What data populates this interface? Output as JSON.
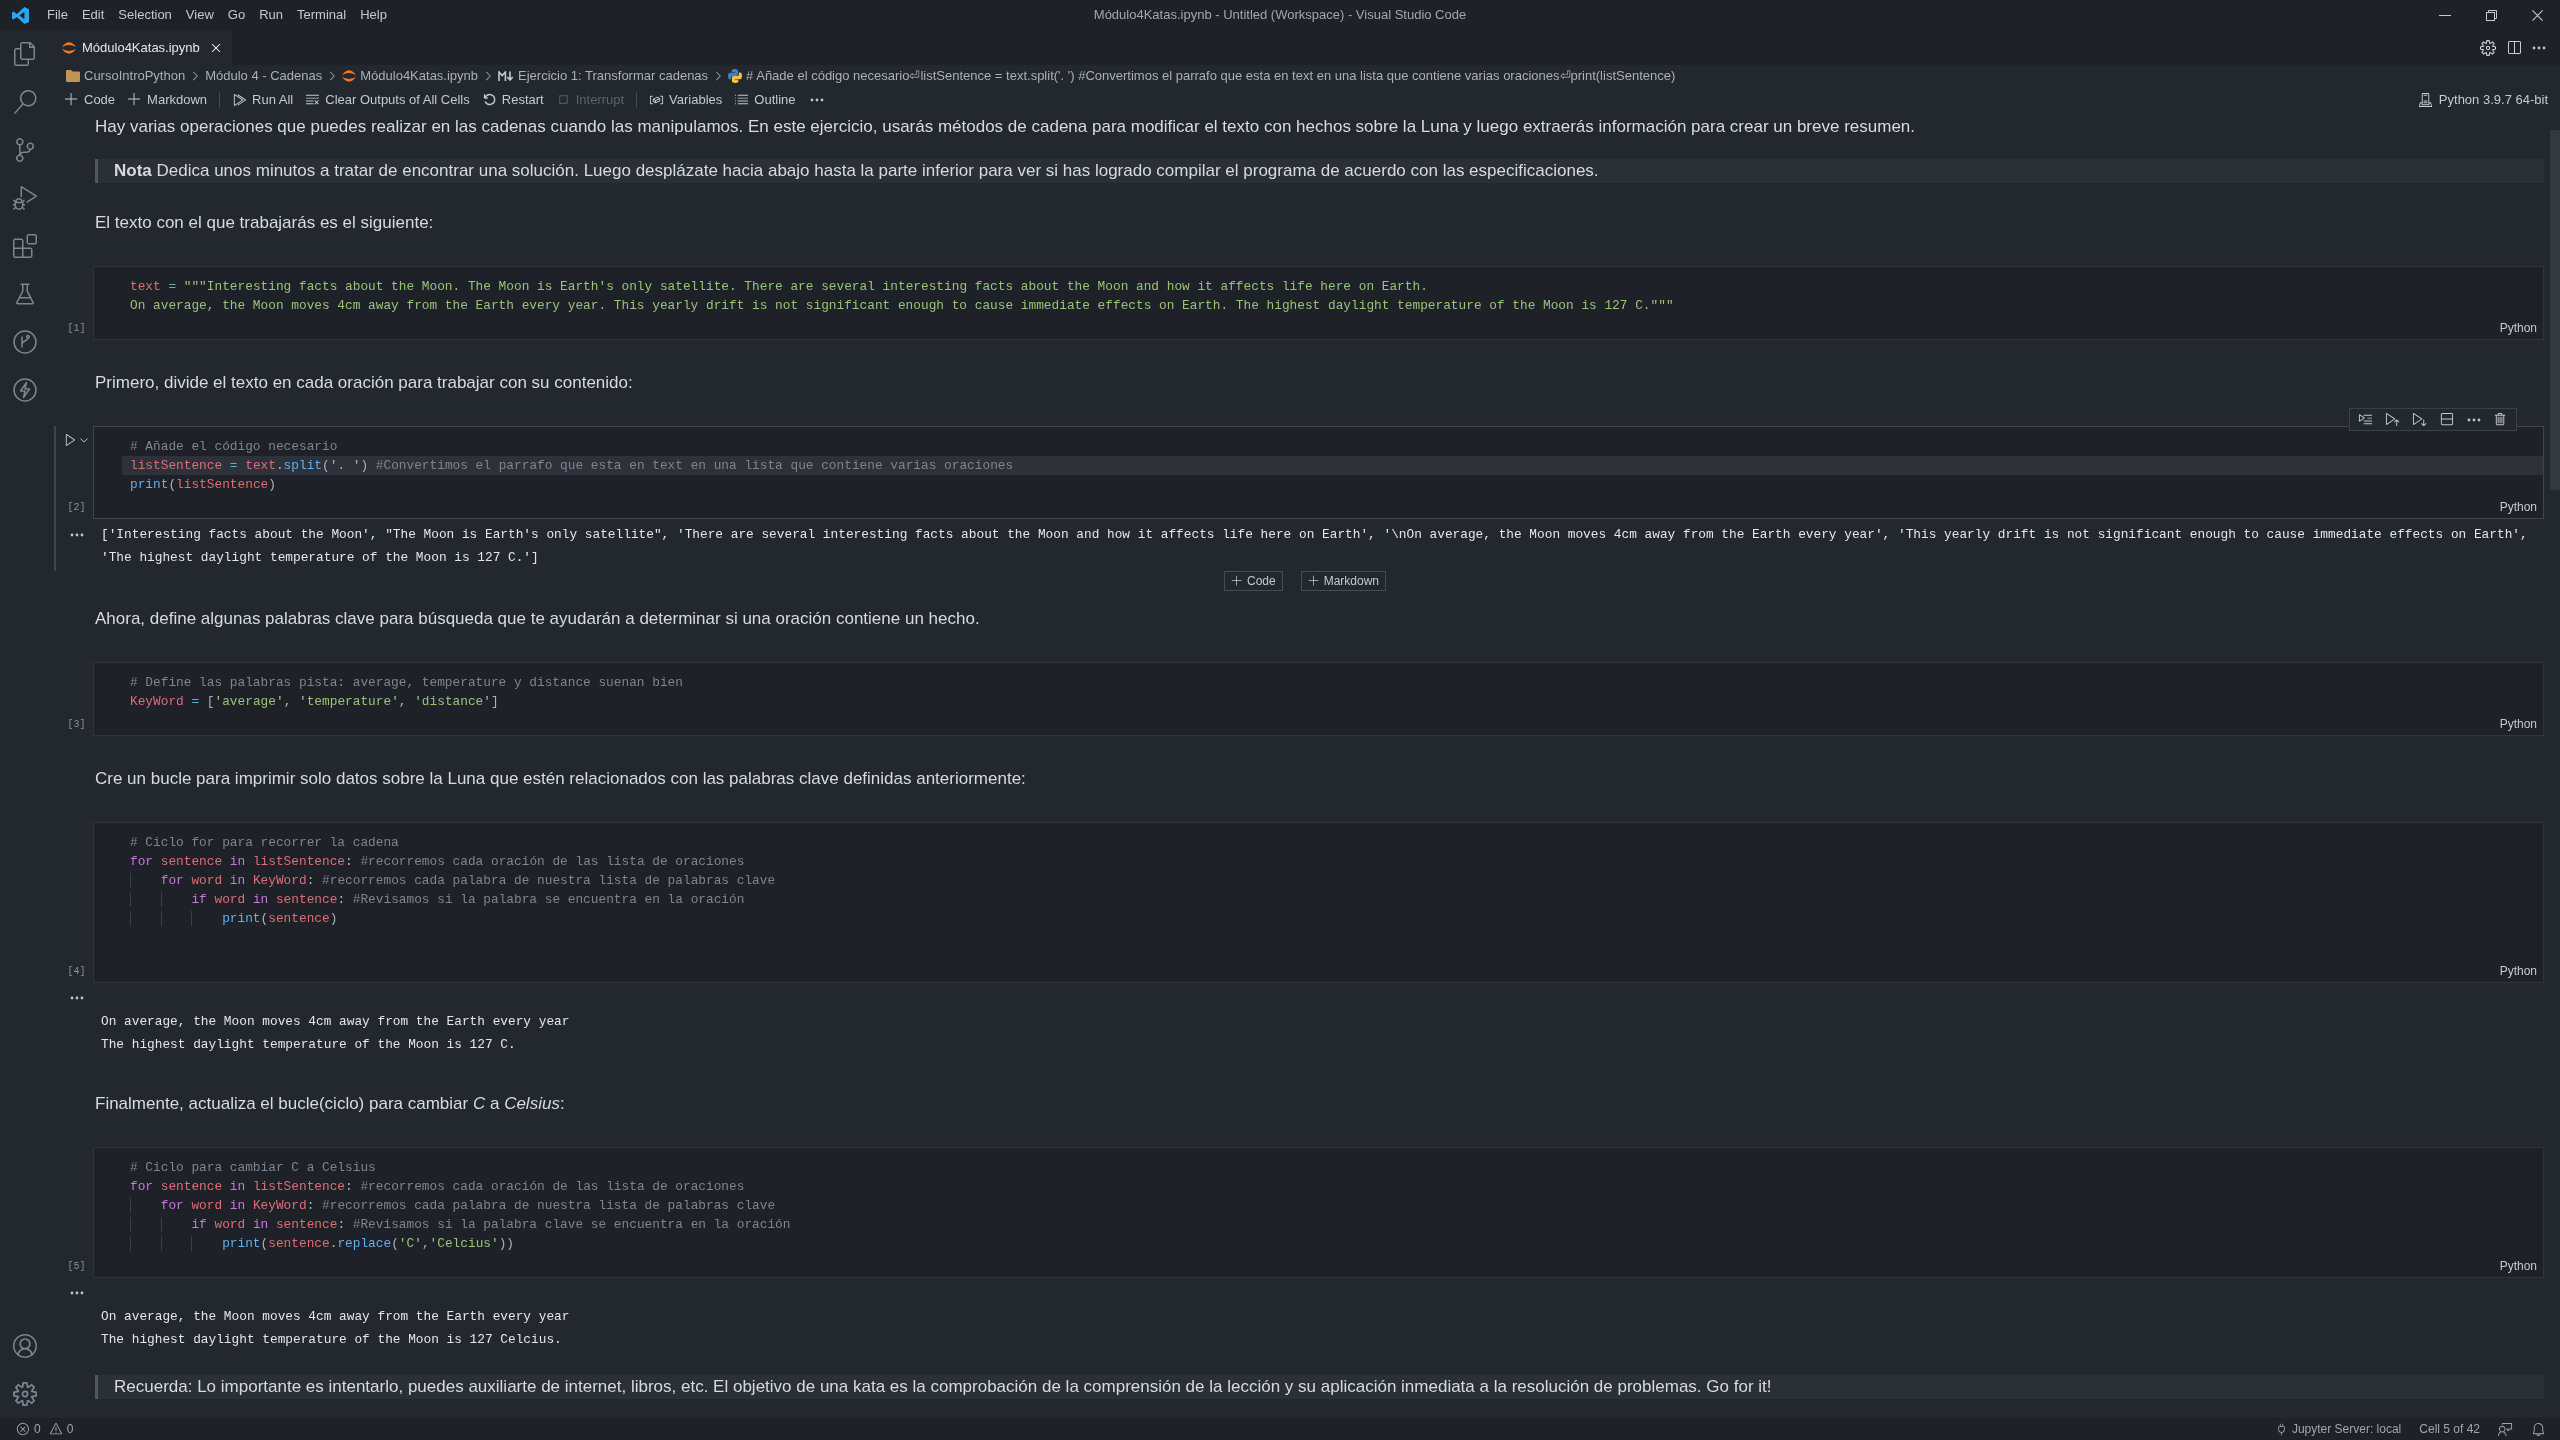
{
  "titlebar": {
    "menus": [
      "File",
      "Edit",
      "Selection",
      "View",
      "Go",
      "Run",
      "Terminal",
      "Help"
    ],
    "title": "Módulo4Katas.ipynb - Untitled (Workspace) - Visual Studio Code"
  },
  "tabs": [
    {
      "label": "Módulo4Katas.ipynb",
      "selected": true
    }
  ],
  "breadcrumbs": [
    {
      "kind": "folder",
      "label": "CursoIntroPython"
    },
    {
      "kind": "plain",
      "label": "Módulo 4 - Cadenas"
    },
    {
      "kind": "notebook",
      "label": "Módulo4Katas.ipynb"
    },
    {
      "kind": "markdown",
      "label": "Ejercicio 1: Transformar cadenas"
    },
    {
      "kind": "python",
      "label": "# Añade el código necesario⏎listSentence = text.split('. ') #Convertimos el parrafo que esta en text en una lista que contiene varias oraciones⏎print(listSentence)"
    }
  ],
  "toolbar": {
    "groups": [
      [
        {
          "kind": "add",
          "label": "Code",
          "disabled": false
        },
        {
          "kind": "add",
          "label": "Markdown",
          "disabled": false
        }
      ],
      [
        {
          "kind": "run",
          "label": "Run All",
          "disabled": false
        },
        {
          "kind": "clear",
          "label": "Clear Outputs of All Cells",
          "disabled": false
        },
        {
          "kind": "restart",
          "label": "Restart",
          "disabled": false
        },
        {
          "kind": "interrupt",
          "label": "Interrupt",
          "disabled": true
        }
      ],
      [
        {
          "kind": "variables",
          "label": "Variables",
          "disabled": false
        },
        {
          "kind": "outline",
          "label": "Outline",
          "disabled": false
        }
      ]
    ],
    "kernel": "Python 3.9.7 64-bit"
  },
  "notebook": {
    "items": [
      {
        "kind": "markdown",
        "text": "Hay varias operaciones que puedes realizar en las cadenas cuando las manipulamos. En este ejercicio, usarás métodos de cadena para modificar el texto con hechos sobre la Luna y luego extraerás información para crear un breve resumen."
      },
      {
        "kind": "quote",
        "text": "**Nota** Dedica unos minutos a tratar de encontrar una solución. Luego desplázate hacia abajo hasta la parte inferior para ver si has logrado compilar el programa de acuerdo con las especificaciones."
      },
      {
        "kind": "markdown",
        "text": "El texto con el que trabajarás es el siguiente:"
      },
      {
        "kind": "code",
        "selected": false,
        "count": "[1]",
        "language": "Python",
        "lines": [
          {
            "current": false,
            "tokens": [
              {
                "kind": "variable",
                "text": "text"
              },
              {
                "kind": "operator",
                "text": " = "
              },
              {
                "kind": "string",
                "text": "\"\"\"Interesting facts about the Moon. The Moon is Earth's only satellite. There are several interesting facts about the Moon and how it affects life here on Earth."
              }
            ]
          },
          {
            "current": false,
            "tokens": [
              {
                "kind": "string",
                "text": "On average, the Moon moves 4cm away from the Earth every year. This yearly drift is not significant enough to cause immediate effects on Earth. The highest daylight temperature of the Moon is 127 C.\"\"\""
              }
            ]
          }
        ]
      },
      {
        "kind": "markdown",
        "text": "Primero, divide el texto en cada oración para trabajar con su contenido:"
      },
      {
        "kind": "code",
        "selected": true,
        "count": "[2]",
        "language": "Python",
        "lines": [
          {
            "current": false,
            "tokens": [
              {
                "kind": "comment",
                "text": "# Añade el código necesario"
              }
            ]
          },
          {
            "current": true,
            "tokens": [
              {
                "kind": "variable",
                "text": "listSentence"
              },
              {
                "kind": "operator",
                "text": " = "
              },
              {
                "kind": "variable",
                "text": "text"
              },
              {
                "kind": "punct",
                "text": "."
              },
              {
                "kind": "function",
                "text": "split"
              },
              {
                "kind": "punct",
                "text": "("
              },
              {
                "kind": "string",
                "text": "'. '"
              },
              {
                "kind": "punct",
                "text": ")"
              },
              {
                "kind": "comment",
                "text": " #Convertimos el parrafo que esta en text en una lista que contiene varias oraciones"
              }
            ]
          },
          {
            "current": false,
            "tokens": [
              {
                "kind": "function",
                "text": "print"
              },
              {
                "kind": "punct",
                "text": "("
              },
              {
                "kind": "variable",
                "text": "listSentence"
              },
              {
                "kind": "punct",
                "text": ")"
              }
            ]
          }
        ],
        "output": {
          "kind": "result",
          "lines": [
            "['Interesting facts about the Moon', \"The Moon is Earth's only satellite\", 'There are several interesting facts about the Moon and how it affects life here on Earth', '\\nOn average, the Moon moves 4cm away from the Earth every year', 'This yearly drift is not significant enough to cause immediate effects on Earth',",
            "'The highest daylight temperature of the Moon is 127 C.']"
          ]
        }
      },
      {
        "kind": "insert",
        "buttons": [
          "Code",
          "Markdown"
        ]
      },
      {
        "kind": "markdown",
        "text": "Ahora, define algunas palabras clave para búsqueda que te ayudarán a determinar si una oración contiene un hecho."
      },
      {
        "kind": "code",
        "selected": false,
        "count": "[3]",
        "language": "Python",
        "lines": [
          {
            "current": false,
            "tokens": [
              {
                "kind": "comment",
                "text": "# Define las palabras pista: average, temperature y distance suenan bien"
              }
            ]
          },
          {
            "current": false,
            "tokens": [
              {
                "kind": "variable",
                "text": "KeyWord"
              },
              {
                "kind": "operator",
                "text": " = "
              },
              {
                "kind": "punct",
                "text": "["
              },
              {
                "kind": "string",
                "text": "'average'"
              },
              {
                "kind": "punct",
                "text": ", "
              },
              {
                "kind": "string",
                "text": "'temperature'"
              },
              {
                "kind": "punct",
                "text": ", "
              },
              {
                "kind": "string",
                "text": "'distance'"
              },
              {
                "kind": "punct",
                "text": "]"
              }
            ]
          }
        ]
      },
      {
        "kind": "markdown",
        "text": "Cre un bucle para imprimir solo datos sobre la Luna que estén relacionados con las palabras clave definidas anteriormente:"
      },
      {
        "kind": "code",
        "selected": false,
        "count": "[4]",
        "language": "Python",
        "lines": [
          {
            "current": false,
            "tokens": [
              {
                "kind": "comment",
                "text": "# Ciclo for para recorrer la cadena"
              }
            ]
          },
          {
            "current": false,
            "tokens": [
              {
                "kind": "keyword",
                "text": "for"
              },
              {
                "kind": "variable",
                "text": " sentence"
              },
              {
                "kind": "keyword",
                "text": " in"
              },
              {
                "kind": "variable",
                "text": " listSentence"
              },
              {
                "kind": "punct",
                "text": ":"
              },
              {
                "kind": "comment",
                "text": " #recorremos cada oración de las lista de oraciones"
              }
            ]
          },
          {
            "current": false,
            "tokens": [
              {
                "kind": "keyword",
                "text": "    for"
              },
              {
                "kind": "variable",
                "text": " word"
              },
              {
                "kind": "keyword",
                "text": " in"
              },
              {
                "kind": "variable",
                "text": " KeyWord"
              },
              {
                "kind": "punct",
                "text": ":"
              },
              {
                "kind": "comment",
                "text": " #recorremos cada palabra de nuestra lista de palabras clave"
              }
            ]
          },
          {
            "current": false,
            "tokens": [
              {
                "kind": "keyword",
                "text": "        if"
              },
              {
                "kind": "variable",
                "text": " word"
              },
              {
                "kind": "keyword",
                "text": " in"
              },
              {
                "kind": "variable",
                "text": " sentence"
              },
              {
                "kind": "punct",
                "text": ":"
              },
              {
                "kind": "comment",
                "text": " #Revisamos si la palabra se encuentra en la oración"
              }
            ]
          },
          {
            "current": false,
            "tokens": [
              {
                "kind": "function",
                "text": "            print"
              },
              {
                "kind": "punct",
                "text": "("
              },
              {
                "kind": "variable",
                "text": "sentence"
              },
              {
                "kind": "punct",
                "text": ")"
              }
            ]
          }
        ],
        "output": {
          "kind": "stream",
          "lines": [
            "On average, the Moon moves 4cm away from the Earth every year",
            "The highest daylight temperature of the Moon is 127 C."
          ]
        }
      },
      {
        "kind": "markdown",
        "text": "Finalmente, actualiza el bucle(ciclo) para cambiar *C* a *Celsius*:"
      },
      {
        "kind": "code",
        "selected": false,
        "count": "[5]",
        "language": "Python",
        "lines": [
          {
            "current": false,
            "tokens": [
              {
                "kind": "comment",
                "text": "# Ciclo para cambiar C a Celsius"
              }
            ]
          },
          {
            "current": false,
            "tokens": [
              {
                "kind": "keyword",
                "text": "for"
              },
              {
                "kind": "variable",
                "text": " sentence"
              },
              {
                "kind": "keyword",
                "text": " in"
              },
              {
                "kind": "variable",
                "text": " listSentence"
              },
              {
                "kind": "punct",
                "text": ":"
              },
              {
                "kind": "comment",
                "text": " #recorremos cada oración de las lista de oraciones"
              }
            ]
          },
          {
            "current": false,
            "tokens": [
              {
                "kind": "keyword",
                "text": "    for"
              },
              {
                "kind": "variable",
                "text": " word"
              },
              {
                "kind": "keyword",
                "text": " in"
              },
              {
                "kind": "variable",
                "text": " KeyWord"
              },
              {
                "kind": "punct",
                "text": ":"
              },
              {
                "kind": "comment",
                "text": " #recorremos cada palabra de nuestra lista de palabras clave"
              }
            ]
          },
          {
            "current": false,
            "tokens": [
              {
                "kind": "keyword",
                "text": "        if"
              },
              {
                "kind": "variable",
                "text": " word"
              },
              {
                "kind": "keyword",
                "text": " in"
              },
              {
                "kind": "variable",
                "text": " sentence"
              },
              {
                "kind": "punct",
                "text": ":"
              },
              {
                "kind": "comment",
                "text": " #Revisamos si la palabra clave se encuentra en la oración"
              }
            ]
          },
          {
            "current": false,
            "tokens": [
              {
                "kind": "function",
                "text": "            print"
              },
              {
                "kind": "punct",
                "text": "("
              },
              {
                "kind": "variable",
                "text": "sentence"
              },
              {
                "kind": "punct",
                "text": "."
              },
              {
                "kind": "function",
                "text": "replace"
              },
              {
                "kind": "punct",
                "text": "("
              },
              {
                "kind": "string",
                "text": "'C'"
              },
              {
                "kind": "punct",
                "text": ","
              },
              {
                "kind": "string",
                "text": "'Celcius'"
              },
              {
                "kind": "punct",
                "text": "))"
              }
            ]
          }
        ],
        "output": {
          "kind": "stream",
          "lines": [
            "On average, the Moon moves 4cm away from the Earth every year",
            "The highest daylight temperature of the Moon is 127 Celcius."
          ]
        }
      },
      {
        "kind": "quote",
        "text": "Recuerda: Lo importante es intentarlo, puedes auxiliarte de internet, libros, etc. El objetivo de una kata es la comprobación de la comprensión de la lección y su aplicación inmediata a la resolución de problemas. Go for it!"
      }
    ]
  },
  "status_bar": {
    "errors": "0",
    "warnings": "0",
    "server": "Jupyter Server: local",
    "cell": "Cell 5 of 42"
  }
}
